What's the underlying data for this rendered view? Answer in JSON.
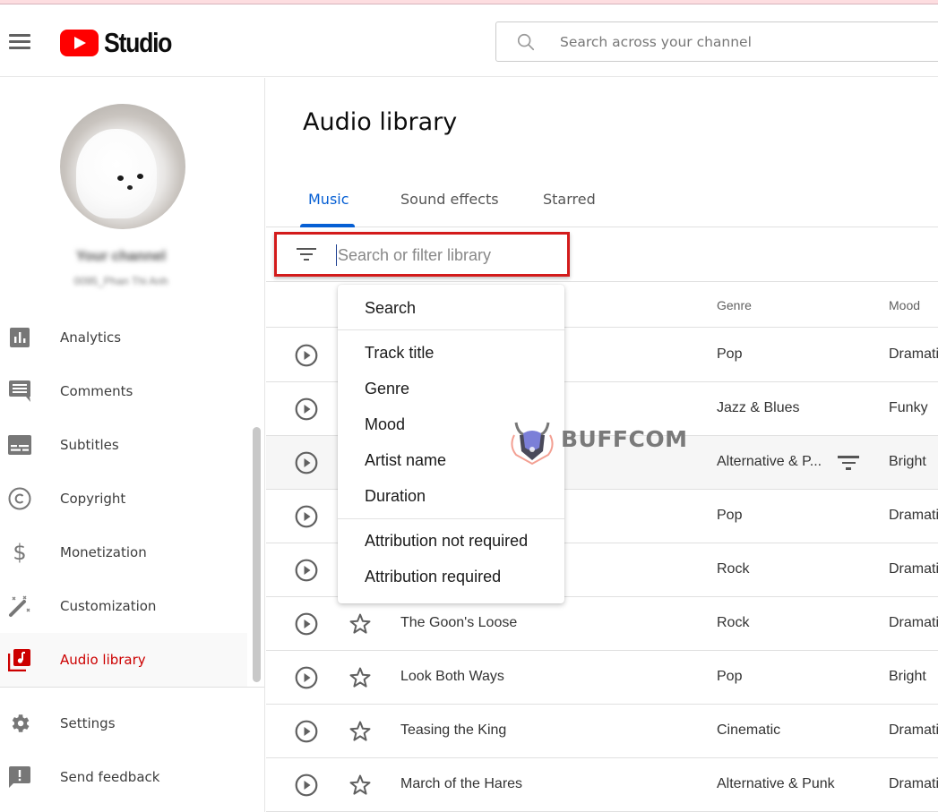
{
  "header": {
    "logo_text": "Studio",
    "search_placeholder": "Search across your channel"
  },
  "sidebar": {
    "channel_name": "Your channel",
    "channel_handle": "0095_Phan Thi Anh",
    "items": [
      {
        "label": "Analytics",
        "icon": "analytics-icon"
      },
      {
        "label": "Comments",
        "icon": "comments-icon"
      },
      {
        "label": "Subtitles",
        "icon": "subtitles-icon"
      },
      {
        "label": "Copyright",
        "icon": "copyright-icon"
      },
      {
        "label": "Monetization",
        "icon": "dollar-icon"
      },
      {
        "label": "Customization",
        "icon": "magic-wand-icon"
      },
      {
        "label": "Audio library",
        "icon": "audio-library-icon",
        "active": true
      }
    ],
    "bottom_items": [
      {
        "label": "Settings",
        "icon": "gear-icon"
      },
      {
        "label": "Send feedback",
        "icon": "feedback-icon"
      }
    ]
  },
  "main": {
    "title": "Audio library",
    "tabs": [
      {
        "label": "Music",
        "active": true
      },
      {
        "label": "Sound effects"
      },
      {
        "label": "Starred"
      }
    ],
    "filter": {
      "placeholder": "Search or filter library",
      "value": ""
    },
    "columns": {
      "genre": "Genre",
      "mood": "Mood"
    },
    "rows": [
      {
        "title": "",
        "genre": "Pop",
        "mood": "Dramatic"
      },
      {
        "title": "",
        "genre": "Jazz & Blues",
        "mood": "Funky"
      },
      {
        "title": "",
        "genre": "Alternative & P...",
        "mood": "Bright",
        "hover": true
      },
      {
        "title": "",
        "genre": "Pop",
        "mood": "Dramatic"
      },
      {
        "title": "",
        "genre": "Rock",
        "mood": "Dramatic"
      },
      {
        "title": "The Goon's Loose",
        "genre": "Rock",
        "mood": "Dramatic"
      },
      {
        "title": "Look Both Ways",
        "genre": "Pop",
        "mood": "Bright"
      },
      {
        "title": "Teasing the King",
        "genre": "Cinematic",
        "mood": "Dramatic"
      },
      {
        "title": "March of the Hares",
        "genre": "Alternative & Punk",
        "mood": "Dramatic"
      }
    ]
  },
  "filter_menu": {
    "items": [
      "Search",
      "Track title",
      "Genre",
      "Mood",
      "Artist name",
      "Duration",
      "Attribution not required",
      "Attribution required"
    ]
  },
  "watermark": {
    "text": "BUFFCOM"
  },
  "colors": {
    "brand_red": "#ff0000",
    "active_nav": "#cc0000",
    "tab_active": "#065fd4",
    "highlight_box": "#d31b1b"
  }
}
